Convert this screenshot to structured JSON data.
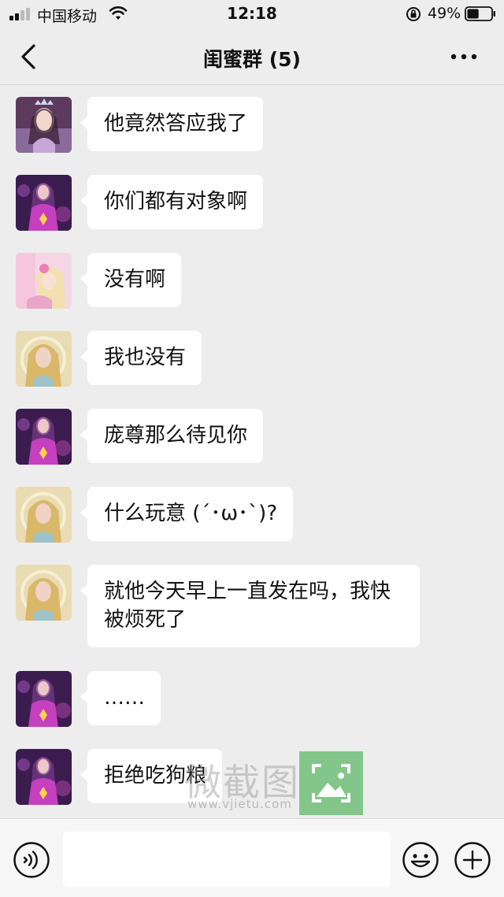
{
  "status_bar": {
    "carrier": "中国移动",
    "time": "12:18",
    "battery_percent": "49%",
    "battery_level": 0.49
  },
  "nav": {
    "title": "闺蜜群 (5)"
  },
  "messages": [
    {
      "avatar": "avatar-princess-crown",
      "text": "他竟然答应我了"
    },
    {
      "avatar": "avatar-purple-fairy",
      "text": "你们都有对象啊"
    },
    {
      "avatar": "avatar-pink-princess",
      "text": "没有啊"
    },
    {
      "avatar": "avatar-golden-fairy",
      "text": "我也没有"
    },
    {
      "avatar": "avatar-purple-fairy",
      "text": "庞尊那么待见你"
    },
    {
      "avatar": "avatar-golden-fairy",
      "text": "什么玩意 (´･ω･`)?"
    },
    {
      "avatar": "avatar-golden-fairy",
      "text": "就他今天早上一直发在吗，我快被烦死了"
    },
    {
      "avatar": "avatar-purple-fairy",
      "text": "……"
    },
    {
      "avatar": "avatar-purple-fairy",
      "text": "拒绝吃狗粮"
    }
  ],
  "watermark": {
    "text": "微截图",
    "url": "www.vjietu.com"
  },
  "input_bar": {
    "value": "",
    "placeholder": ""
  },
  "icons": {
    "back": "chevron-left-icon",
    "more": "more-dots-icon",
    "voice": "voice-icon",
    "emoji": "emoji-icon",
    "plus": "plus-icon"
  },
  "colors": {
    "background": "#ededed",
    "bubble": "#ffffff",
    "input_bar": "#f6f6f6",
    "watermark_green": "#6ebe78"
  }
}
